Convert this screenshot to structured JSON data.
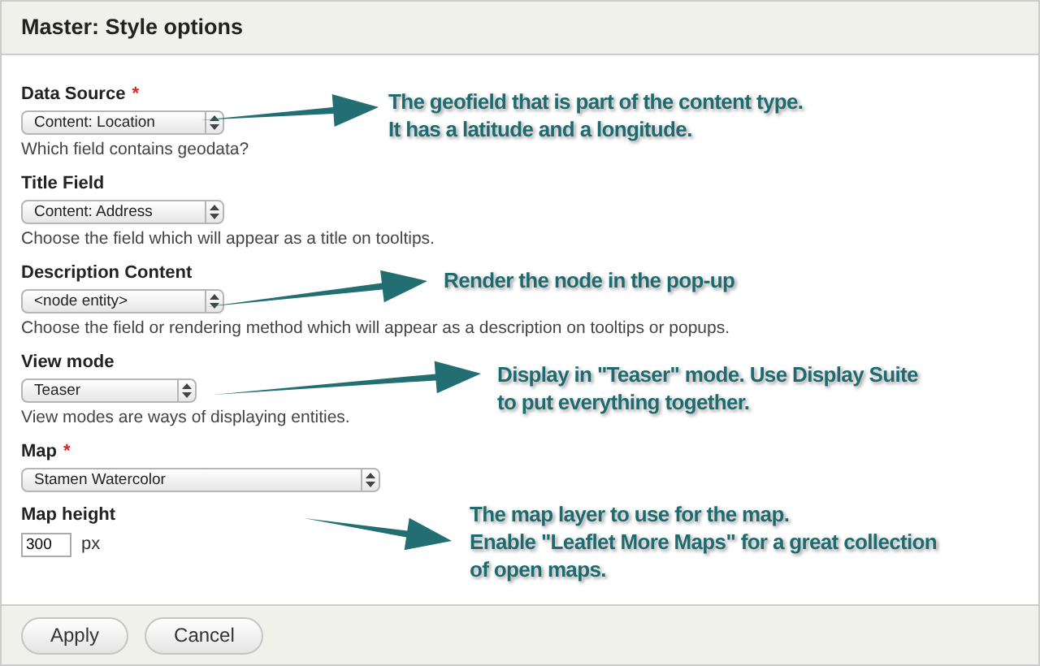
{
  "dialog": {
    "title": "Master: Style options"
  },
  "fields": [
    {
      "label": "Data Source",
      "required_mark": "*",
      "kind": "select",
      "value": "Content: Location",
      "description": "Which field contains geodata?"
    },
    {
      "label": "Title Field",
      "kind": "select",
      "value": "Content: Address",
      "description": "Choose the field which will appear as a title on tooltips."
    },
    {
      "label": "Description Content",
      "kind": "select",
      "value": "<node entity>",
      "description": "Choose the field or rendering method which will appear as a description on tooltips or popups."
    },
    {
      "label": "View mode",
      "kind": "select",
      "value": "Teaser",
      "description": "View modes are ways of displaying entities."
    },
    {
      "label": "Map",
      "required_mark": "*",
      "kind": "wide-select",
      "value": "Stamen Watercolor"
    },
    {
      "label": "Map height",
      "kind": "number",
      "value": "300",
      "suffix": "px"
    }
  ],
  "annotations": [
    {
      "lines": [
        "The geofield that is part of the content type.",
        "It has a latitude and a longitude."
      ]
    },
    {
      "lines": [
        "Render the node in the pop-up"
      ]
    },
    {
      "lines": [
        "Display in \"Teaser\" mode. Use Display Suite",
        "to put everything together."
      ]
    },
    {
      "lines": [
        "The map layer to use for the map.",
        "Enable \"Leaflet More Maps\" for a great collection",
        "of open maps."
      ]
    }
  ],
  "buttons": [
    "Apply",
    "Cancel"
  ]
}
